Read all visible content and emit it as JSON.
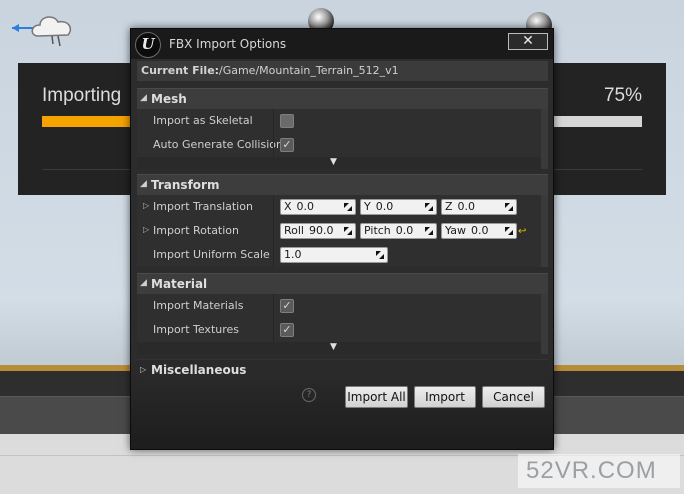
{
  "progress": {
    "label": "Importing",
    "percent_text": "75%",
    "fraction": 0.75
  },
  "dialog": {
    "title": "FBX Import Options",
    "logo_text": "U",
    "close_glyph": "✕",
    "current_file_label": "Current File:",
    "current_file_value": "/Game/Mountain_Terrain_512_v1"
  },
  "sections": {
    "mesh": {
      "label": "Mesh",
      "rows": [
        {
          "label": "Import as Skeletal",
          "checked": false
        },
        {
          "label": "Auto Generate Collision",
          "checked": true
        }
      ]
    },
    "transform": {
      "label": "Transform",
      "translation": {
        "label": "Import Translation",
        "x_axis": "X",
        "x": "0.0",
        "y_axis": "Y",
        "y": "0.0",
        "z_axis": "Z",
        "z": "0.0"
      },
      "rotation": {
        "label": "Import Rotation",
        "roll_axis": "Roll",
        "roll": "90.0",
        "pitch_axis": "Pitch",
        "pitch": "0.0",
        "yaw_axis": "Yaw",
        "yaw": "0.0"
      },
      "scale": {
        "label": "Import Uniform Scale",
        "value": "1.0"
      }
    },
    "material": {
      "label": "Material",
      "rows": [
        {
          "label": "Import Materials",
          "checked": true
        },
        {
          "label": "Import Textures",
          "checked": true
        }
      ]
    },
    "misc": {
      "label": "Miscellaneous"
    }
  },
  "buttons": {
    "import_all": "Import All",
    "import": "Import",
    "cancel": "Cancel",
    "help_glyph": "?"
  },
  "glyphs": {
    "expanded": "◢",
    "collapsed": "▷",
    "down_chevron": "▼",
    "check": "✓",
    "reset": "↩"
  },
  "watermark": "52VR.COM",
  "colors": {
    "progress_fill": "#f4a300",
    "reset_arrow": "#e6c200"
  }
}
